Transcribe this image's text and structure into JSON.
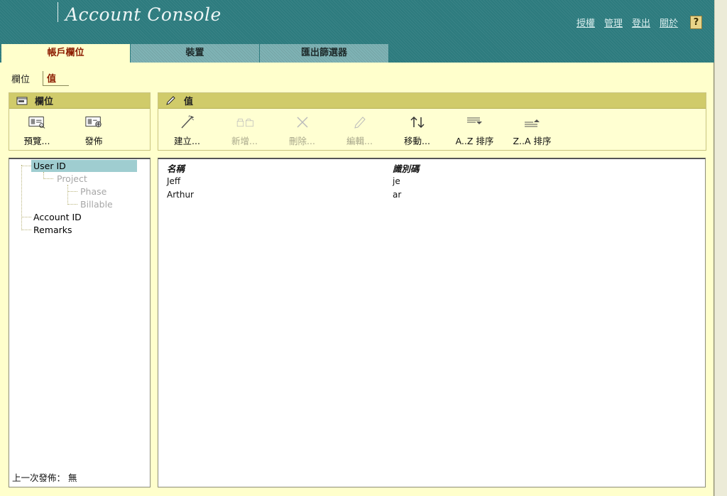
{
  "app": {
    "title": "Account Console",
    "links": [
      "授權",
      "管理",
      "登出",
      "關於"
    ],
    "help_label": "?"
  },
  "tabs": [
    {
      "label": "帳戶欄位",
      "active": true
    },
    {
      "label": "裝置",
      "active": false
    },
    {
      "label": "匯出篩選器",
      "active": false
    }
  ],
  "subnav": {
    "fields_label": "欄位",
    "values_label": "值"
  },
  "fields_panel": {
    "title": "欄位",
    "tools": [
      {
        "label": "預覽...",
        "icon": "preview-icon",
        "enabled": true
      },
      {
        "label": "發佈",
        "icon": "publish-icon",
        "enabled": true
      }
    ]
  },
  "values_panel": {
    "title": "值",
    "tools": [
      {
        "label": "建立...",
        "icon": "create-icon",
        "enabled": true
      },
      {
        "label": "新增...",
        "icon": "add-icon",
        "enabled": false
      },
      {
        "label": "刪除...",
        "icon": "delete-icon",
        "enabled": false
      },
      {
        "label": "編輯...",
        "icon": "edit-icon",
        "enabled": false
      },
      {
        "label": "移動...",
        "icon": "move-icon",
        "enabled": true
      },
      {
        "label": "A..Z 排序",
        "icon": "sort-az-icon",
        "enabled": true
      },
      {
        "label": "Z..A 排序",
        "icon": "sort-za-icon",
        "enabled": true
      }
    ]
  },
  "tree": [
    {
      "label": "User ID",
      "selected": true,
      "enabled": true
    },
    {
      "label": "Project",
      "selected": false,
      "enabled": false
    },
    {
      "label": "Phase",
      "selected": false,
      "enabled": false
    },
    {
      "label": "Billable",
      "selected": false,
      "enabled": false
    },
    {
      "label": "Account ID",
      "selected": false,
      "enabled": true
    },
    {
      "label": "Remarks",
      "selected": false,
      "enabled": true
    }
  ],
  "last_publish": "上一次發佈： 無",
  "table": {
    "columns": [
      "名稱",
      "識別碼"
    ],
    "rows": [
      [
        "Jeff",
        "je"
      ],
      [
        "Arthur",
        "ar"
      ]
    ]
  },
  "colors": {
    "banner": "#2d7b7e",
    "background": "#ffffcc",
    "panel_header": "#d0cb6a",
    "active_tab_text": "#8c1c00",
    "selection": "#9fcdd0"
  }
}
